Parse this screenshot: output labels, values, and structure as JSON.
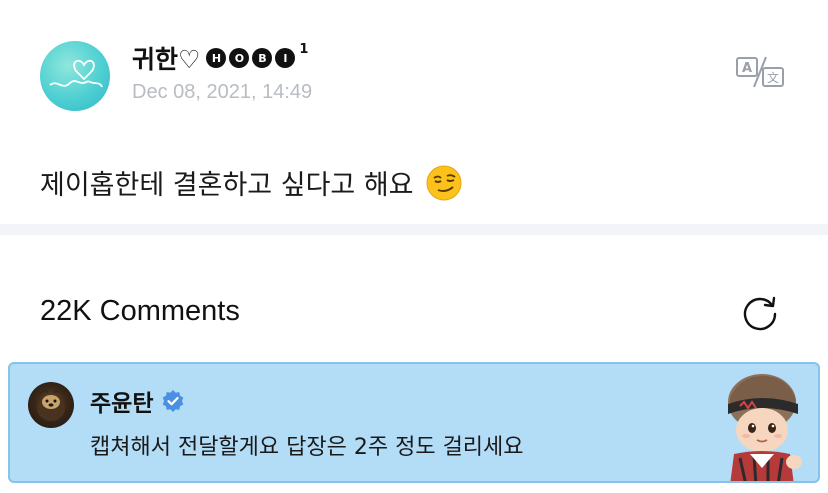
{
  "post": {
    "author_name": "귀한♡",
    "author_badge_letters": [
      "H",
      "O",
      "B",
      "I"
    ],
    "author_superscript": "1",
    "timestamp": "Dec 08, 2021, 14:49",
    "body_text": "제이홉한테 결혼하고 싶다고 해요",
    "body_emoji": "smirking-face-emoji"
  },
  "icons": {
    "translate": "translate-icon",
    "refresh": "refresh-icon",
    "verified": "verified-badge-icon"
  },
  "comments": {
    "count_label": "22K Comments"
  },
  "pinned_comment": {
    "author": "주윤탄",
    "text": "캡쳐해서 전달할게요 답장은 2주 정도 걸리세요",
    "background_color": "#b3dcf7",
    "border_color": "#86c2ea"
  },
  "colors": {
    "timestamp": "#b8bcc3",
    "verified_blue": "#4a90e2",
    "divider": "#f2f4f8"
  }
}
